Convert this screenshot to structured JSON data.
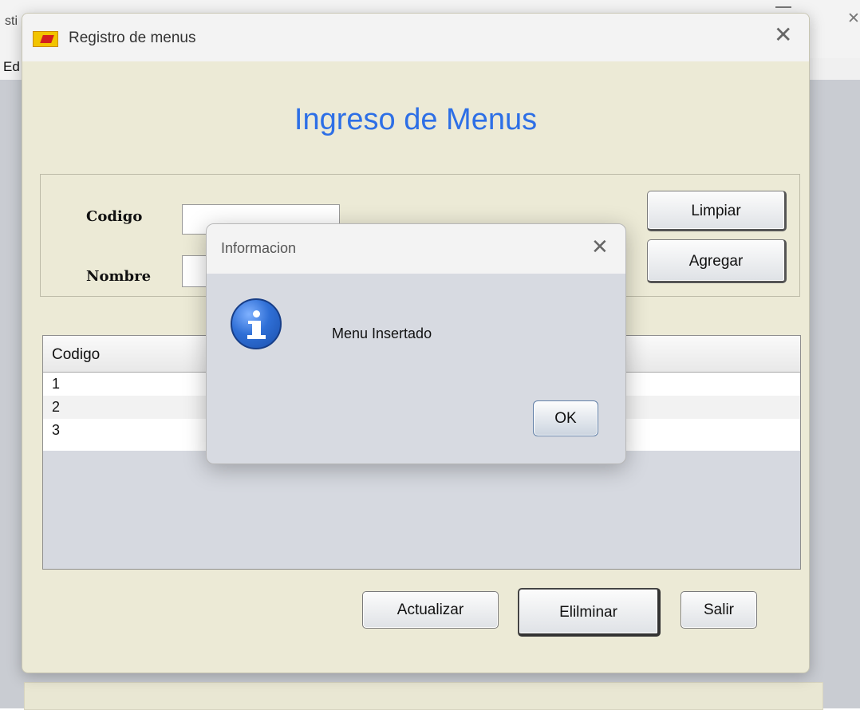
{
  "background": {
    "title_fragment": "sti",
    "menu_fragment": "Ed"
  },
  "window": {
    "title": "Registro de menus",
    "heading": "Ingreso de Menus",
    "form": {
      "codigo_label": "Codigo",
      "nombre_label": "Nombre",
      "codigo_value": "",
      "nombre_value": ""
    },
    "buttons": {
      "limpiar": "Limpiar",
      "agregar": "Agregar",
      "actualizar": "Actualizar",
      "eliminar": "Elilminar",
      "salir": "Salir"
    },
    "table": {
      "column_header": "Codigo",
      "rows": [
        "1",
        "2",
        "3"
      ]
    }
  },
  "dialog": {
    "title": "Informacion",
    "message": "Menu Insertado",
    "ok_label": "OK",
    "icon": "info-icon"
  },
  "colors": {
    "heading": "#2d6fe6",
    "window_bg": "#ecead6",
    "dialog_bg": "#d7dae1"
  }
}
